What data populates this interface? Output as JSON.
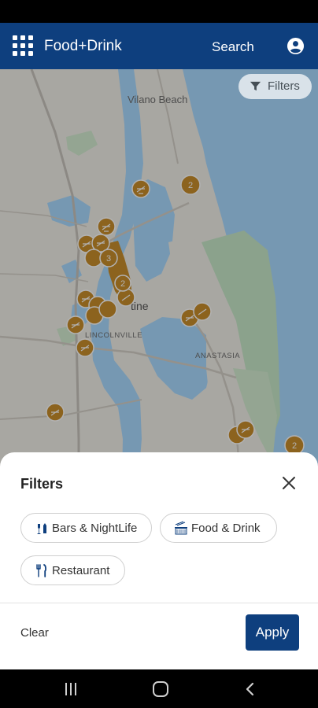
{
  "app_bar": {
    "title": "Food+Drink",
    "search_label": "Search",
    "menu_icon": "grid-menu-icon",
    "account_icon": "account-icon",
    "background": "#0e3f7e"
  },
  "map": {
    "filters_button_label": "Filters",
    "labels": {
      "vilano": "Vilano Beach",
      "augustine": "tine",
      "lincolnville": "LINCOLNVILLE",
      "anastasia": "ANASTASIA"
    },
    "cluster_counts": {
      "north": "2",
      "downtown_a": "3",
      "downtown_b": "2",
      "south_east": "2"
    },
    "marker_color": "#c98e2c"
  },
  "filters_sheet": {
    "title": "Filters",
    "chips": [
      {
        "label": "Bars & NightLife",
        "icon": "bar-drinks-icon"
      },
      {
        "label": "Food & Drink",
        "icon": "food-drink-icon"
      },
      {
        "label": "Restaurant",
        "icon": "fork-knife-icon"
      }
    ],
    "clear_label": "Clear",
    "apply_label": "Apply"
  },
  "system_nav": {
    "recents_icon": "recents-icon",
    "home_icon": "home-icon",
    "back_icon": "back-icon"
  }
}
